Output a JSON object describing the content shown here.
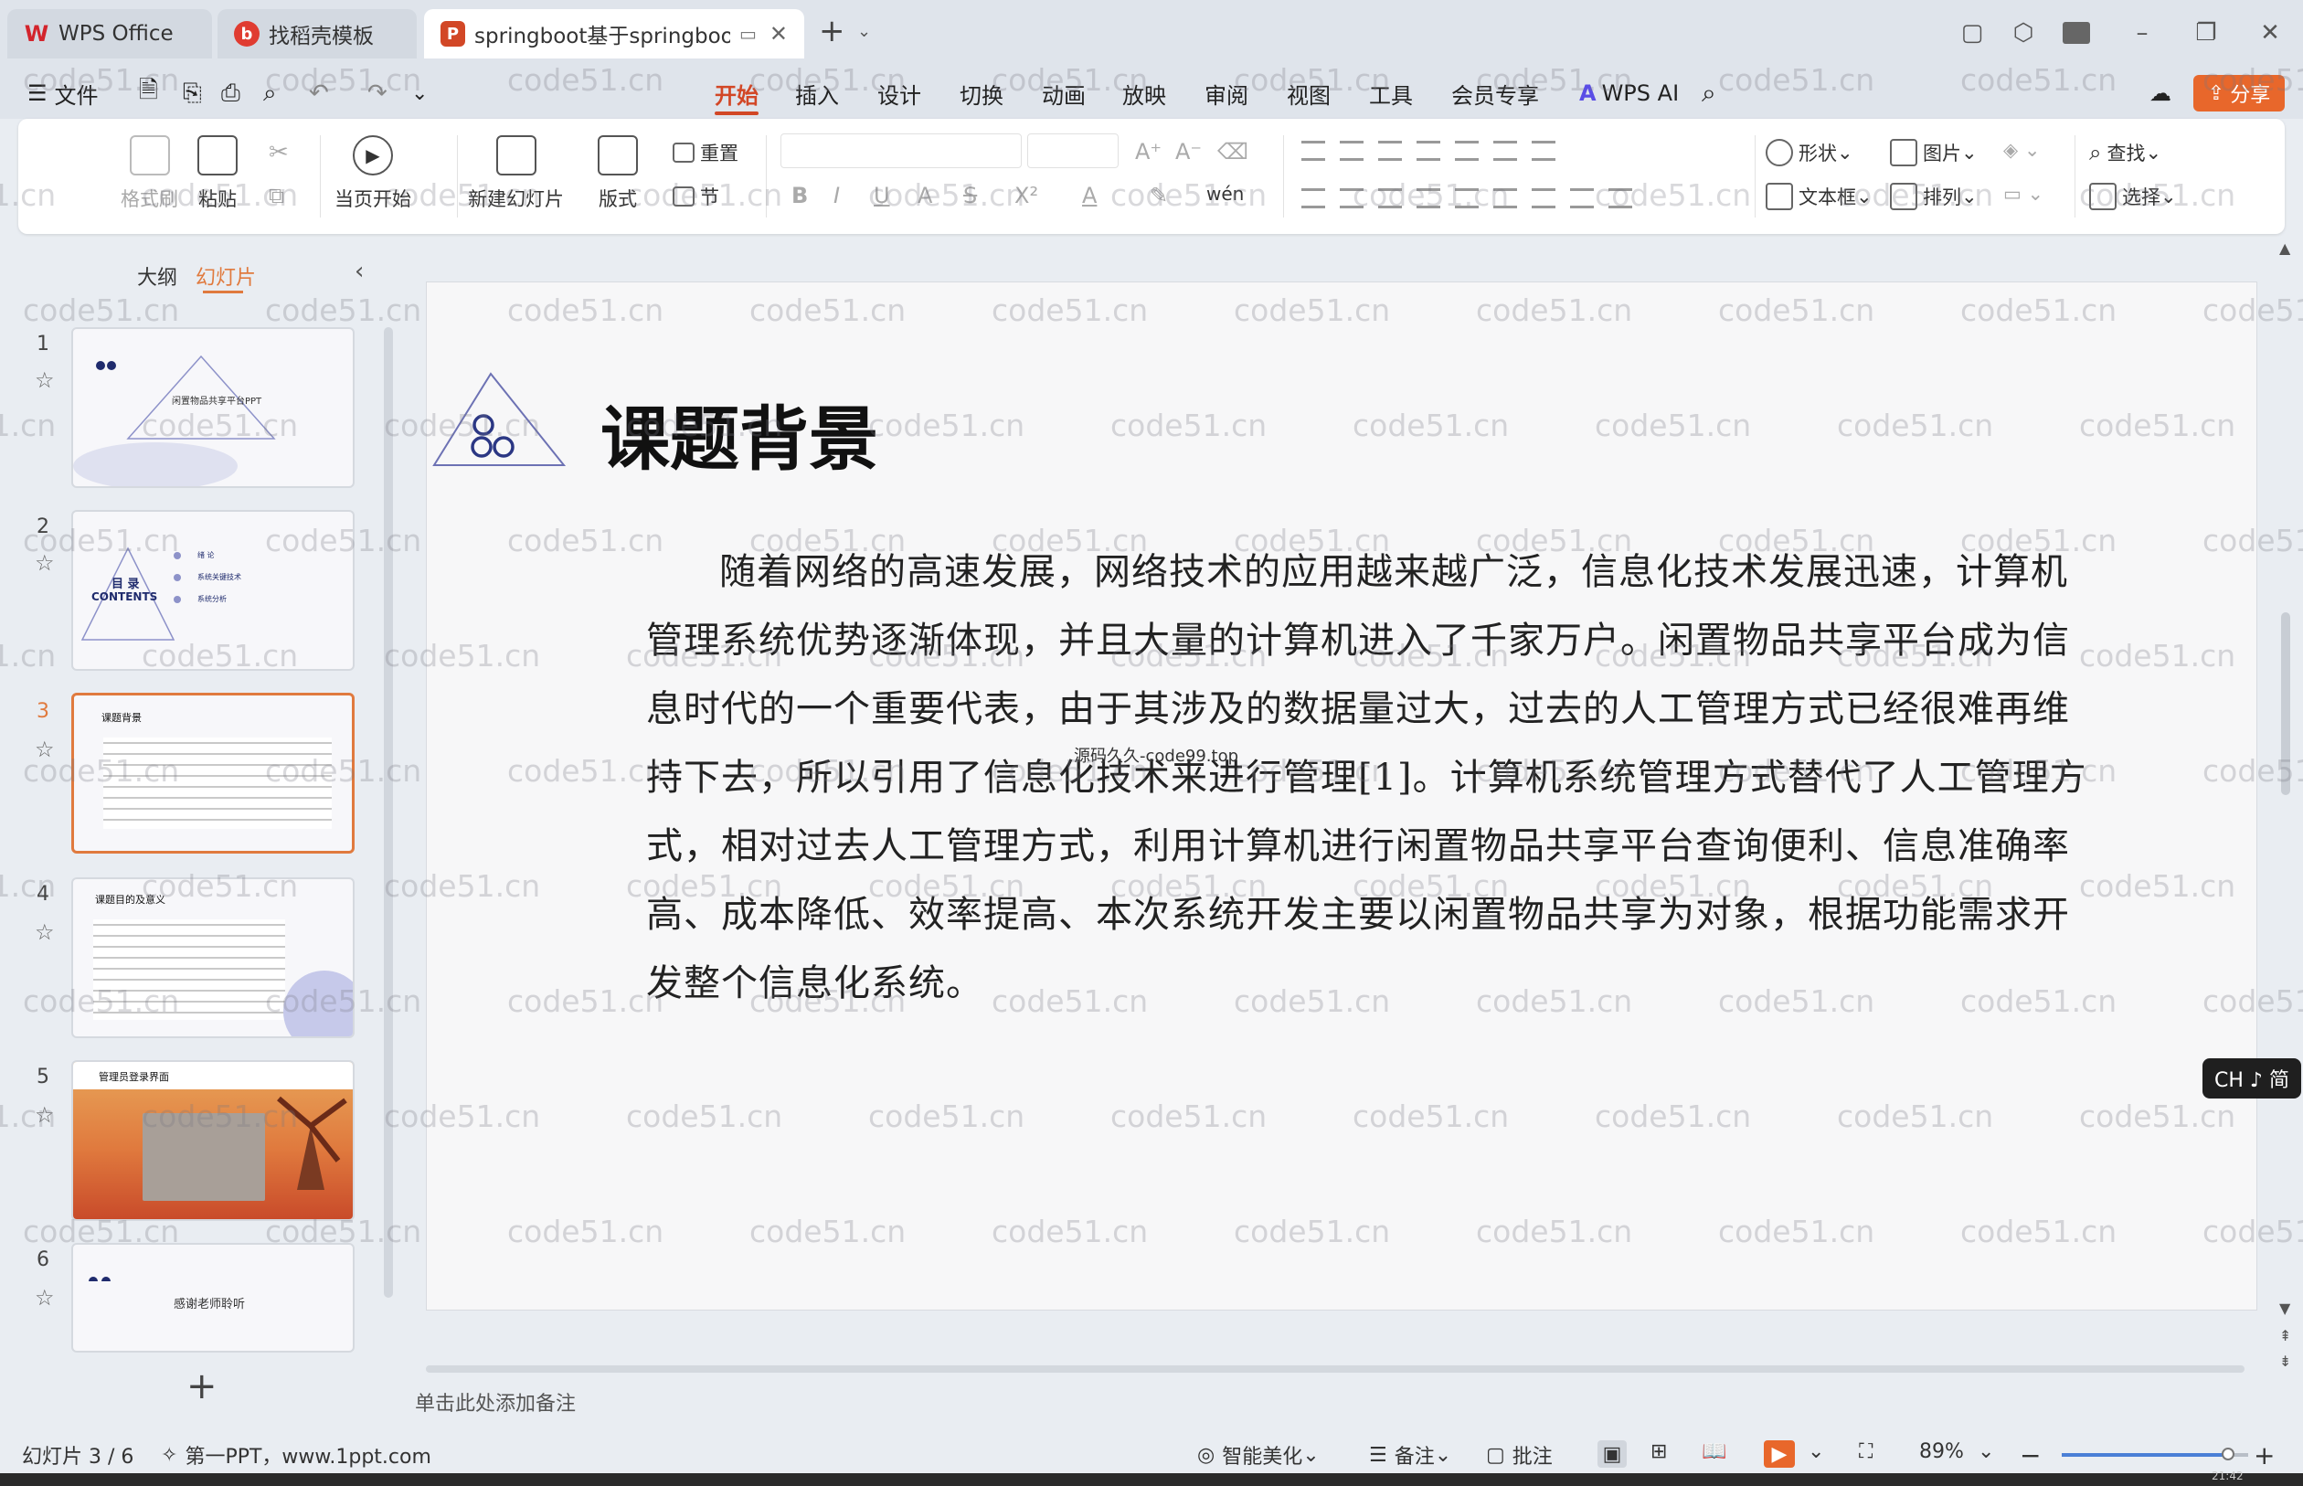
{
  "window": {
    "tabs": [
      {
        "label": "WPS Office",
        "icon": "wps-logo-icon"
      },
      {
        "label": "找稻壳模板",
        "icon": "docer-icon"
      },
      {
        "label": "springboot基于springboot闲",
        "icon": "ppt-file-icon"
      }
    ],
    "add_tab": "+"
  },
  "menu": {
    "file": "文件",
    "tabs": [
      "开始",
      "插入",
      "设计",
      "切换",
      "动画",
      "放映",
      "审阅",
      "视图",
      "工具",
      "会员专享"
    ],
    "active_tab": "开始",
    "wps_ai": "WPS AI",
    "share": "分享"
  },
  "ribbon": {
    "format_painter": "格式刷",
    "paste": "粘贴",
    "start_from_current": "当页开始",
    "new_slide": "新建幻灯片",
    "layout": "版式",
    "reset": "重置",
    "section": "节",
    "shape": "形状",
    "picture": "图片",
    "find": "查找",
    "textbox": "文本框",
    "arrange": "排列",
    "select": "选择"
  },
  "panel": {
    "outline_tab": "大纲",
    "slides_tab": "幻灯片",
    "thumbs": [
      {
        "num": "1",
        "title": "闲置物品共享平台PPT"
      },
      {
        "num": "2",
        "title": "目 录",
        "subtitle": "CONTENTS",
        "items": [
          "绪 论",
          "系统关键技术",
          "系统分析"
        ]
      },
      {
        "num": "3",
        "title": "课题背景"
      },
      {
        "num": "4",
        "title": "课题目的及意义"
      },
      {
        "num": "5",
        "title": "管理员登录界面"
      },
      {
        "num": "6",
        "title": "感谢老师聆听"
      }
    ],
    "add_slide": "+"
  },
  "slide": {
    "title": "课题背景",
    "paragraph": "随着网络的高速发展，网络技术的应用越来越广泛，信息化技术发展迅速，计算机管理系统优势逐渐体现，并且大量的计算机进入了千家万户。闲置物品共享平台成为信息时代的一个重要代表，由于其涉及的数据量过大，过去的人工管理方式已经很难再维持下去，所以引用了信息化技术来进行管理[1]。计算机系统管理方式替代了人工管理方式，相对过去人工管理方式，利用计算机进行闲置物品共享平台查询便利、信息准确率高、成本降低、效率提高、本次系统开发主要以闲置物品共享为对象，根据功能需求开发整个信息化系统。",
    "overlay_text": "源码久久-code99.top"
  },
  "notes": {
    "placeholder": "单击此处添加备注"
  },
  "status": {
    "slide_counter": "幻灯片 3 / 6",
    "theme": "第一PPT，www.1ppt.com",
    "beautify": "智能美化",
    "notes": "备注",
    "comment": "批注",
    "zoom": "89%",
    "zoom_level": 0.89,
    "ime": "CH ♪ 简",
    "clock": "21:42"
  },
  "watermark": "code51.cn",
  "colors": {
    "accent": "#d24726",
    "selection": "#e07a3e",
    "share_button": "#e8672b"
  }
}
